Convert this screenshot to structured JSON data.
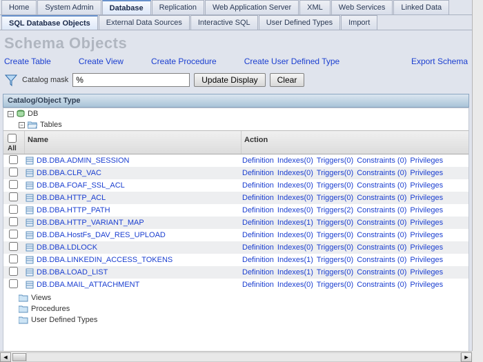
{
  "top_tabs": [
    {
      "label": "Home",
      "active": false
    },
    {
      "label": "System Admin",
      "active": false
    },
    {
      "label": "Database",
      "active": true
    },
    {
      "label": "Replication",
      "active": false
    },
    {
      "label": "Web Application Server",
      "active": false
    },
    {
      "label": "XML",
      "active": false
    },
    {
      "label": "Web Services",
      "active": false
    },
    {
      "label": "Linked Data",
      "active": false
    }
  ],
  "sub_tabs": [
    {
      "label": "SQL Database Objects",
      "active": true
    },
    {
      "label": "External Data Sources",
      "active": false
    },
    {
      "label": "Interactive SQL",
      "active": false
    },
    {
      "label": "User Defined Types",
      "active": false
    },
    {
      "label": "Import",
      "active": false
    }
  ],
  "page_title": "Schema Objects",
  "action_links": {
    "create_table": "Create Table",
    "create_view": "Create View",
    "create_procedure": "Create Procedure",
    "create_udt": "Create User Defined Type",
    "export_schema": "Export Schema"
  },
  "filter": {
    "label": "Catalog mask",
    "value": "%",
    "update_btn": "Update Display",
    "clear_btn": "Clear"
  },
  "section_header": "Catalog/Object Type",
  "tree": {
    "db_label": "DB",
    "tables_label": "Tables",
    "views_label": "Views",
    "procedures_label": "Procedures",
    "udt_label": "User Defined Types"
  },
  "table": {
    "all_label": "All",
    "name_header": "Name",
    "action_header": "Action",
    "rows": [
      {
        "name": "DB.DBA.ADMIN_SESSION",
        "idx": 0,
        "trig": 0,
        "con": 0
      },
      {
        "name": "DB.DBA.CLR_VAC",
        "idx": 0,
        "trig": 0,
        "con": 0
      },
      {
        "name": "DB.DBA.FOAF_SSL_ACL",
        "idx": 0,
        "trig": 0,
        "con": 0
      },
      {
        "name": "DB.DBA.HTTP_ACL",
        "idx": 0,
        "trig": 0,
        "con": 0
      },
      {
        "name": "DB.DBA.HTTP_PATH",
        "idx": 0,
        "trig": 2,
        "con": 0
      },
      {
        "name": "DB.DBA.HTTP_VARIANT_MAP",
        "idx": 1,
        "trig": 0,
        "con": 0
      },
      {
        "name": "DB.DBA.HostFs_DAV_RES_UPLOAD",
        "idx": 0,
        "trig": 0,
        "con": 0
      },
      {
        "name": "DB.DBA.LDLOCK",
        "idx": 0,
        "trig": 0,
        "con": 0
      },
      {
        "name": "DB.DBA.LINKEDIN_ACCESS_TOKENS",
        "idx": 1,
        "trig": 0,
        "con": 0
      },
      {
        "name": "DB.DBA.LOAD_LIST",
        "idx": 1,
        "trig": 0,
        "con": 0
      },
      {
        "name": "DB.DBA.MAIL_ATTACHMENT",
        "idx": 0,
        "trig": 0,
        "con": 0
      }
    ],
    "action_parts": {
      "definition": "Definition",
      "indexes": "Indexes",
      "triggers": "Triggers",
      "constraints": "Constraints",
      "privileges": "Privileges"
    }
  }
}
